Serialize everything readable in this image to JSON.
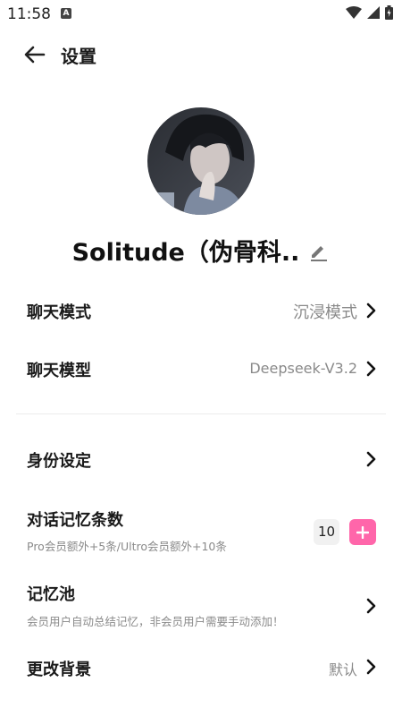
{
  "status_bar": {
    "time": "11:58",
    "notification": "A"
  },
  "header": {
    "title": "设置"
  },
  "profile": {
    "nickname": "Solitude（伪骨科.."
  },
  "settings": {
    "chat_mode": {
      "label": "聊天模式",
      "value": "沉浸模式"
    },
    "chat_model": {
      "label": "聊天模型",
      "value": "Deepseek-V3.2"
    },
    "identity": {
      "label": "身份设定"
    },
    "memory_count": {
      "label": "对话记忆条数",
      "sub": "Pro会员额外+5条/Ultro会员额外+10条",
      "value": "10"
    },
    "memory_pool": {
      "label": "记忆池",
      "sub": "会员用户自动总结记忆，非会员用户需要手动添加！"
    },
    "background": {
      "label": "更改背景",
      "value": "默认"
    }
  },
  "colors": {
    "accent": "#ff66aa",
    "muted": "#8a8a8a",
    "divider": "#ececec"
  }
}
